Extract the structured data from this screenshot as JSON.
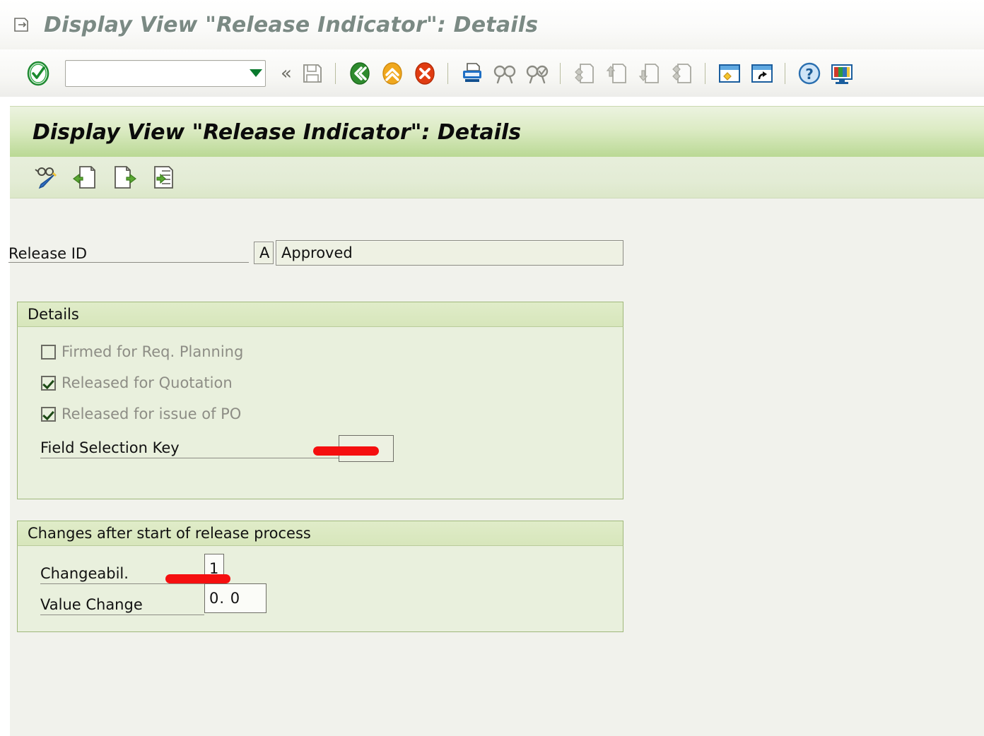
{
  "window": {
    "title": "Display View \"Release Indicator\": Details",
    "title_icon": "window-menu-icon"
  },
  "system_toolbar": {
    "ok_button_name": "enter-ok-icon",
    "command_field": {
      "value": "",
      "placeholder": ""
    },
    "dropdown_icon": "chevron-down-icon",
    "collapse_icon": "«",
    "buttons": [
      {
        "name": "save-button",
        "tooltip": "Save",
        "enabled": false
      },
      {
        "name": "back-button",
        "tooltip": "Back",
        "enabled": true
      },
      {
        "name": "exit-button",
        "tooltip": "Exit",
        "enabled": true
      },
      {
        "name": "cancel-button",
        "tooltip": "Cancel",
        "enabled": true
      },
      {
        "name": "print-button",
        "tooltip": "Print",
        "enabled": true
      },
      {
        "name": "find-button",
        "tooltip": "Find",
        "enabled": true
      },
      {
        "name": "find-next-button",
        "tooltip": "Find Next",
        "enabled": true
      },
      {
        "name": "first-page-button",
        "tooltip": "First Page",
        "enabled": false
      },
      {
        "name": "previous-page-button",
        "tooltip": "Previous Page",
        "enabled": false
      },
      {
        "name": "next-page-button",
        "tooltip": "Next Page",
        "enabled": false
      },
      {
        "name": "last-page-button",
        "tooltip": "Last Page",
        "enabled": false
      },
      {
        "name": "new-session-button",
        "tooltip": "Create New Session",
        "enabled": true
      },
      {
        "name": "shortcut-button",
        "tooltip": "Create Shortcut",
        "enabled": true
      },
      {
        "name": "help-button",
        "tooltip": "Help",
        "enabled": true
      },
      {
        "name": "customize-button",
        "tooltip": "Customize Local Layout",
        "enabled": true
      }
    ]
  },
  "screen": {
    "banner_title": "Display View \"Release Indicator\": Details",
    "app_toolbar": [
      {
        "name": "display-change-button",
        "tooltip": "Display/Change"
      },
      {
        "name": "previous-entry-button",
        "tooltip": "Previous Entry"
      },
      {
        "name": "next-entry-button",
        "tooltip": "Next Entry"
      },
      {
        "name": "other-entry-button",
        "tooltip": "Other Entry"
      }
    ]
  },
  "form": {
    "release_id": {
      "label": "Release ID",
      "key_value": "A",
      "description": "Approved"
    },
    "details_group": {
      "title": "Details",
      "checkboxes": [
        {
          "label": "Firmed for Req. Planning",
          "checked": false,
          "enabled": false
        },
        {
          "label": "Released for Quotation",
          "checked": true,
          "enabled": false
        },
        {
          "label": "Released for issue of PO",
          "checked": true,
          "enabled": false
        }
      ],
      "field_selection_key": {
        "label": "Field Selection Key",
        "value": ""
      }
    },
    "changes_group": {
      "title": "Changes after start of release process",
      "changeability": {
        "label": "Changeabil.",
        "value": "1"
      },
      "value_change": {
        "label": "Value Change",
        "value": "0. 0"
      }
    }
  },
  "annotations": {
    "highlight_color": "#f50f0f",
    "marks": [
      {
        "name": "field-selection-key-highlight"
      },
      {
        "name": "changeability-highlight"
      }
    ]
  }
}
